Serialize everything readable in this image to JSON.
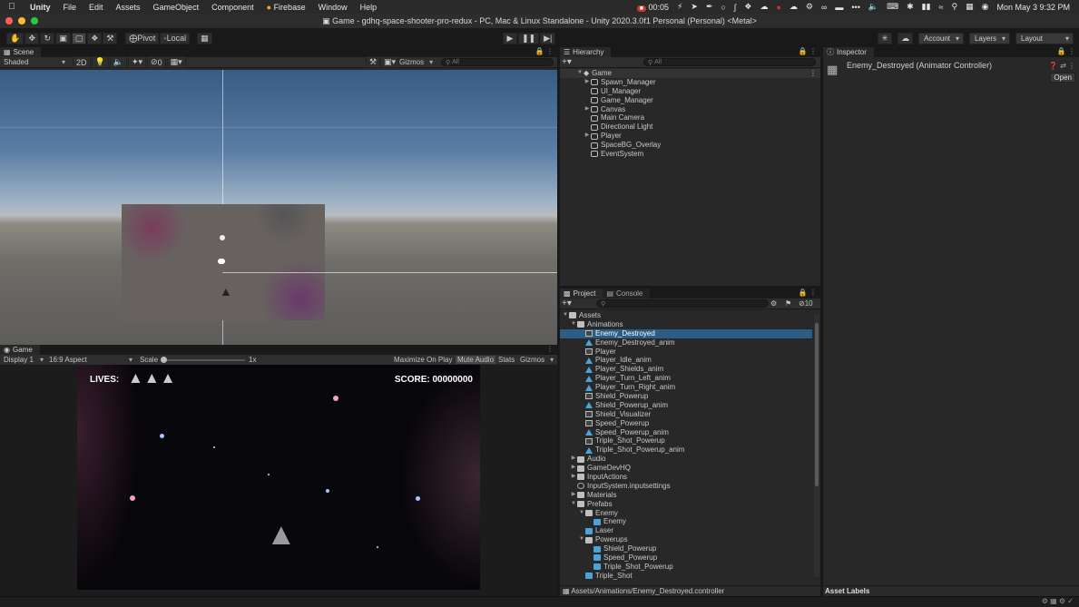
{
  "menubar": {
    "app": "Unity",
    "menus": [
      "File",
      "Edit",
      "Assets",
      "GameObject",
      "Component",
      "Firebase",
      "Window",
      "Help"
    ],
    "timer": "00:05",
    "clock": "Mon May 3  9:32 PM"
  },
  "window": {
    "title": "Game - gdhq-space-shooter-pro-redux - PC, Mac & Linux Standalone - Unity 2020.3.0f1 Personal (Personal) <Metal>"
  },
  "toolbar": {
    "pivot": "Pivot",
    "local": "Local",
    "account": "Account",
    "layers": "Layers",
    "layout": "Layout"
  },
  "scene": {
    "tab": "Scene",
    "shading": "Shaded",
    "mode_2d": "2D",
    "hidden_count": "0",
    "gizmos": "Gizmos",
    "search": "All"
  },
  "game": {
    "tab": "Game",
    "display": "Display 1",
    "aspect": "16:9 Aspect",
    "scale_label": "Scale",
    "scale_value": "1x",
    "maximize": "Maximize On Play",
    "mute": "Mute Audio",
    "stats": "Stats",
    "gizmos": "Gizmos",
    "lives_label": "LIVES:",
    "score_text": "SCORE: 00000000"
  },
  "hierarchy": {
    "tab": "Hierarchy",
    "search": "All",
    "scene_name": "Game",
    "items": [
      {
        "label": "Spawn_Manager",
        "expandable": true
      },
      {
        "label": "UI_Manager",
        "expandable": false
      },
      {
        "label": "Game_Manager",
        "expandable": false
      },
      {
        "label": "Canvas",
        "expandable": true
      },
      {
        "label": "Main Camera",
        "expandable": false
      },
      {
        "label": "Directional Light",
        "expandable": false
      },
      {
        "label": "Player",
        "expandable": true
      },
      {
        "label": "SpaceBG_Overlay",
        "expandable": false
      },
      {
        "label": "EventSystem",
        "expandable": false
      }
    ]
  },
  "project": {
    "tab_project": "Project",
    "tab_console": "Console",
    "count": "10",
    "path": "Assets/Animations/Enemy_Destroyed.controller",
    "tree": [
      {
        "label": "Assets",
        "depth": 0,
        "icon": "folder",
        "arrow": "open"
      },
      {
        "label": "Animations",
        "depth": 1,
        "icon": "folder",
        "arrow": "open"
      },
      {
        "label": "Enemy_Destroyed",
        "depth": 2,
        "icon": "controller",
        "arrow": "",
        "selected": true
      },
      {
        "label": "Enemy_Destroyed_anim",
        "depth": 2,
        "icon": "anim",
        "arrow": ""
      },
      {
        "label": "Player",
        "depth": 2,
        "icon": "controller",
        "arrow": ""
      },
      {
        "label": "Player_Idle_anim",
        "depth": 2,
        "icon": "anim",
        "arrow": ""
      },
      {
        "label": "Player_Shields_anim",
        "depth": 2,
        "icon": "anim",
        "arrow": ""
      },
      {
        "label": "Player_Turn_Left_anim",
        "depth": 2,
        "icon": "anim",
        "arrow": ""
      },
      {
        "label": "Player_Turn_Right_anim",
        "depth": 2,
        "icon": "anim",
        "arrow": ""
      },
      {
        "label": "Shield_Powerup",
        "depth": 2,
        "icon": "controller",
        "arrow": ""
      },
      {
        "label": "Shield_Powerup_anim",
        "depth": 2,
        "icon": "anim",
        "arrow": ""
      },
      {
        "label": "Shield_Visualizer",
        "depth": 2,
        "icon": "controller",
        "arrow": ""
      },
      {
        "label": "Speed_Powerup",
        "depth": 2,
        "icon": "controller",
        "arrow": ""
      },
      {
        "label": "Speed_Powerup_anim",
        "depth": 2,
        "icon": "anim",
        "arrow": ""
      },
      {
        "label": "Triple_Shot_Powerup",
        "depth": 2,
        "icon": "controller",
        "arrow": ""
      },
      {
        "label": "Triple_Shot_Powerup_anim",
        "depth": 2,
        "icon": "anim",
        "arrow": ""
      },
      {
        "label": "Audio",
        "depth": 1,
        "icon": "folder",
        "arrow": "closed"
      },
      {
        "label": "GameDevHQ",
        "depth": 1,
        "icon": "folder",
        "arrow": "closed"
      },
      {
        "label": "InputActions",
        "depth": 1,
        "icon": "folder",
        "arrow": "closed"
      },
      {
        "label": "InputSystem.inputsettings",
        "depth": 1,
        "icon": "settings",
        "arrow": ""
      },
      {
        "label": "Materials",
        "depth": 1,
        "icon": "folder",
        "arrow": "closed"
      },
      {
        "label": "Prefabs",
        "depth": 1,
        "icon": "folder",
        "arrow": "open"
      },
      {
        "label": "Enemy",
        "depth": 2,
        "icon": "folder",
        "arrow": "open"
      },
      {
        "label": "Enemy",
        "depth": 3,
        "icon": "prefab",
        "arrow": ""
      },
      {
        "label": "Laser",
        "depth": 2,
        "icon": "prefab",
        "arrow": ""
      },
      {
        "label": "Powerups",
        "depth": 2,
        "icon": "folder",
        "arrow": "open"
      },
      {
        "label": "Shield_Powerup",
        "depth": 3,
        "icon": "prefab",
        "arrow": ""
      },
      {
        "label": "Speed_Powerup",
        "depth": 3,
        "icon": "prefab",
        "arrow": ""
      },
      {
        "label": "Triple_Shot_Powerup",
        "depth": 3,
        "icon": "prefab",
        "arrow": ""
      },
      {
        "label": "Triple_Shot",
        "depth": 2,
        "icon": "prefab",
        "arrow": ""
      }
    ]
  },
  "inspector": {
    "tab": "Inspector",
    "object_name": "Enemy_Destroyed (Animator Controller)",
    "open_button": "Open",
    "asset_labels": "Asset Labels"
  },
  "colors": {
    "selection": "#2c5d87",
    "panel": "#282828",
    "background": "#191919"
  }
}
